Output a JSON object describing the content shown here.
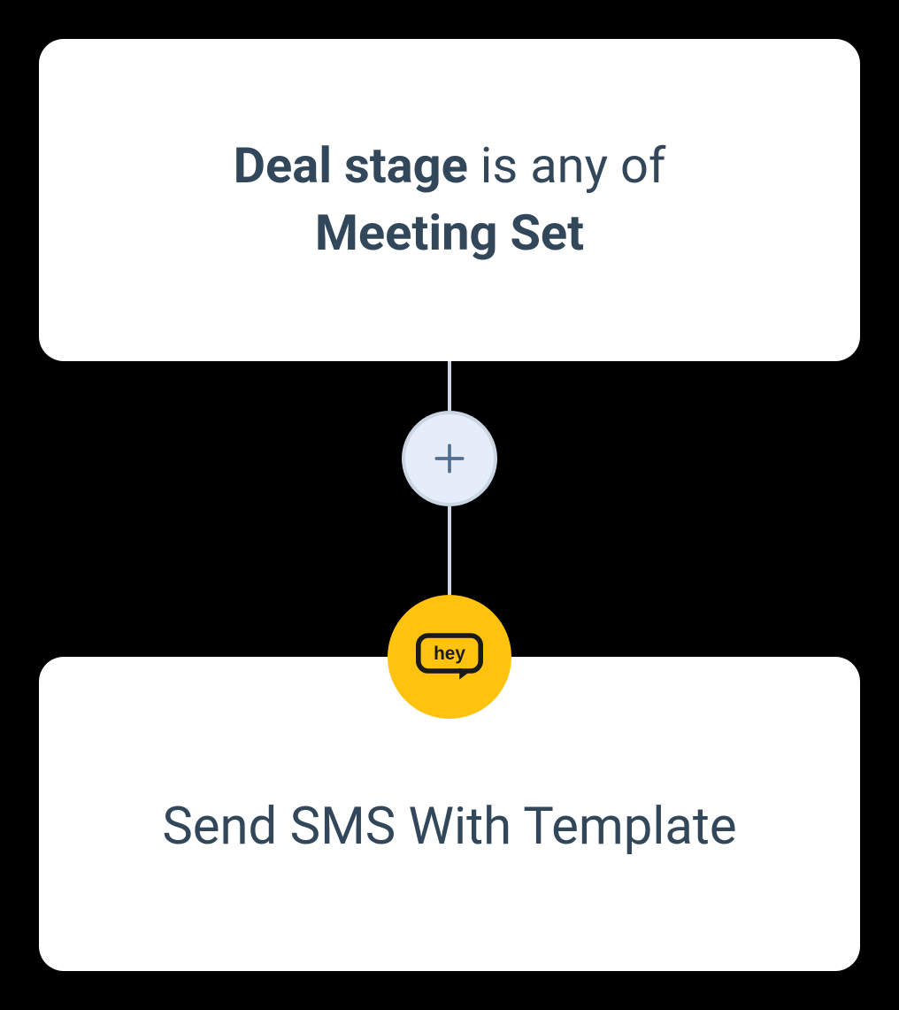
{
  "trigger": {
    "property_label": "Deal stage",
    "operator_text": "is any of",
    "value": "Meeting Set"
  },
  "action": {
    "label": "Send SMS With Template",
    "app_icon_name": "hey-logo-icon"
  },
  "add_button": {
    "icon_name": "plus-icon"
  }
}
